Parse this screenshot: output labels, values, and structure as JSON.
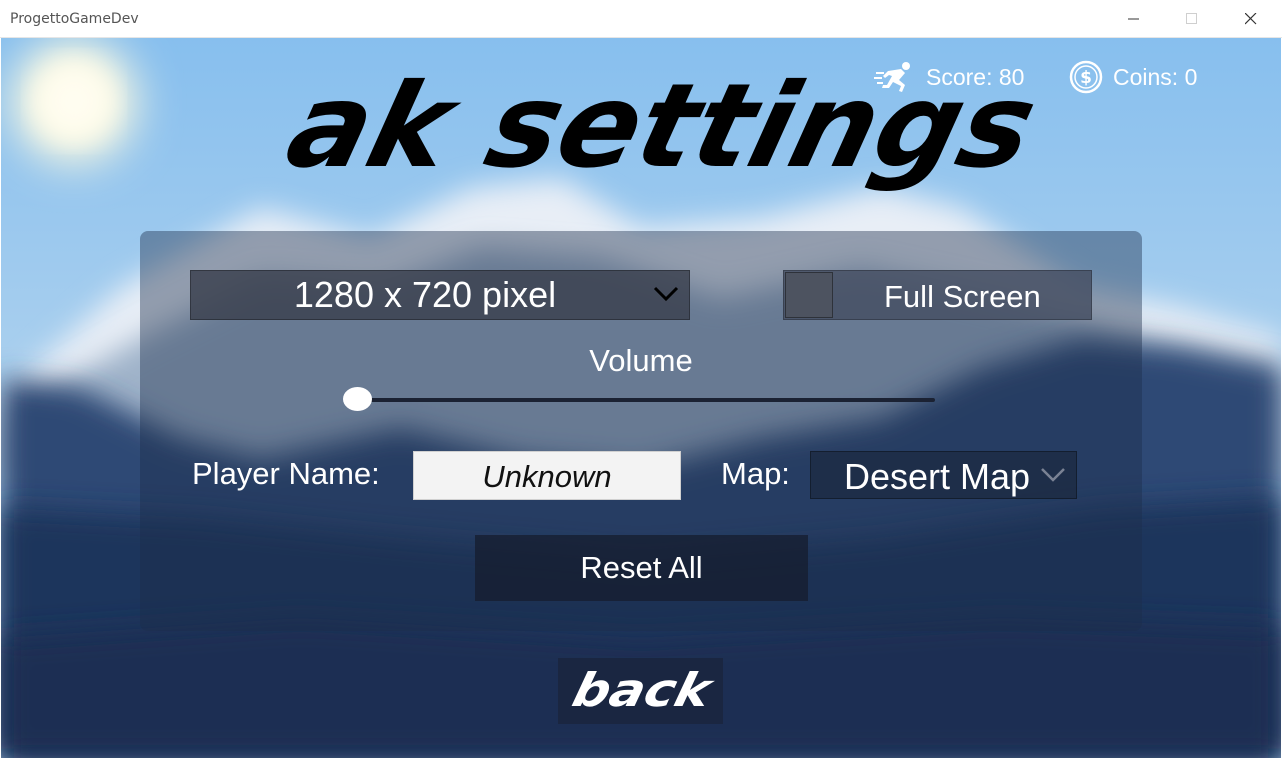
{
  "window": {
    "title": "ProgettoGameDev"
  },
  "hud": {
    "score_text": "Score: 80",
    "coins_text": "Coins: 0",
    "score_icon": "running-person-icon",
    "coins_icon": "dollar-coin-icon"
  },
  "title": {
    "text": "ak settings"
  },
  "settings": {
    "resolution": {
      "selected": "1280 x 720 pixel"
    },
    "fullscreen": {
      "label": "Full Screen",
      "checked": false
    },
    "volume": {
      "label": "Volume",
      "level": 0
    },
    "player": {
      "label": "Player Name:",
      "value": "Unknown"
    },
    "map": {
      "label": "Map:",
      "selected": "Desert Map"
    },
    "reset_label": "Reset All"
  },
  "back": {
    "label": "back"
  },
  "colors": {
    "sky": "#8dc1ea",
    "panel": "#1c2d4b",
    "button_dark": "#161e30"
  }
}
